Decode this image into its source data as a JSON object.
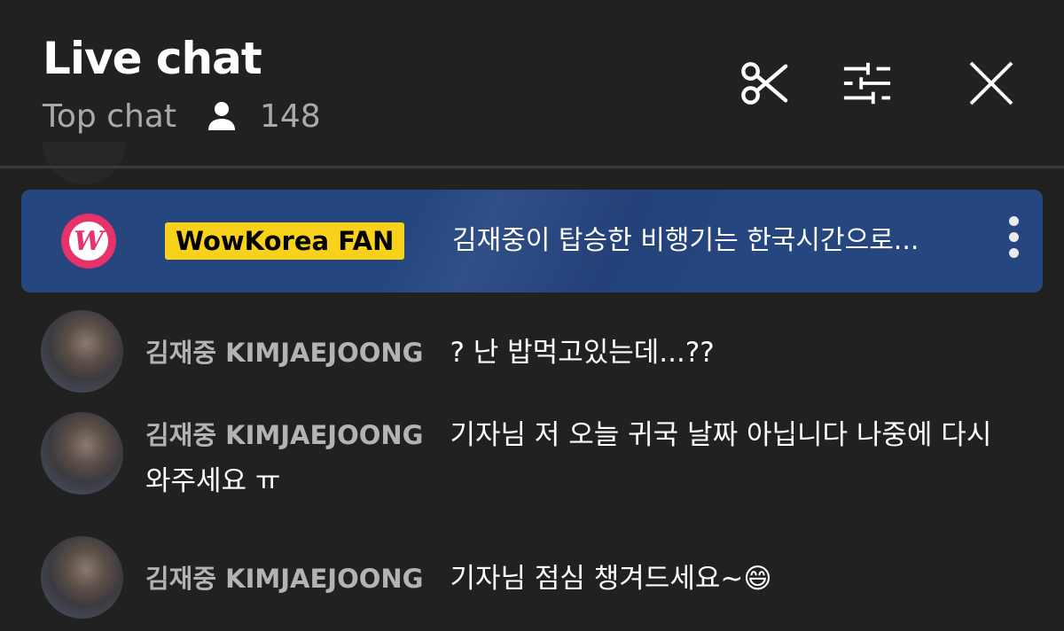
{
  "header": {
    "title": "Live chat",
    "mode": "Top chat",
    "viewer_count": "148",
    "icons": [
      "scissors-icon",
      "tune-icon",
      "close-icon"
    ]
  },
  "pinned": {
    "badge": "WowKorea FAN",
    "message": "김재중이 탑승한 비행기는 한국시간으로...",
    "logo_letter": "W",
    "colors": {
      "banner": "#264680",
      "badge": "#f8d21a",
      "logo": "#e8336a"
    }
  },
  "messages": [
    {
      "author": "김재중 KIMJAEJOONG",
      "text": "? 난 밥먹고있는데...??"
    },
    {
      "author": "김재중 KIMJAEJOONG",
      "text": "기자님 저 오늘 귀국 날짜 아닙니다 나중에 다시 와주세요 ㅠ"
    },
    {
      "author": "김재중 KIMJAEJOONG",
      "text": "기자님 점심 챙겨드세요~😄"
    }
  ]
}
